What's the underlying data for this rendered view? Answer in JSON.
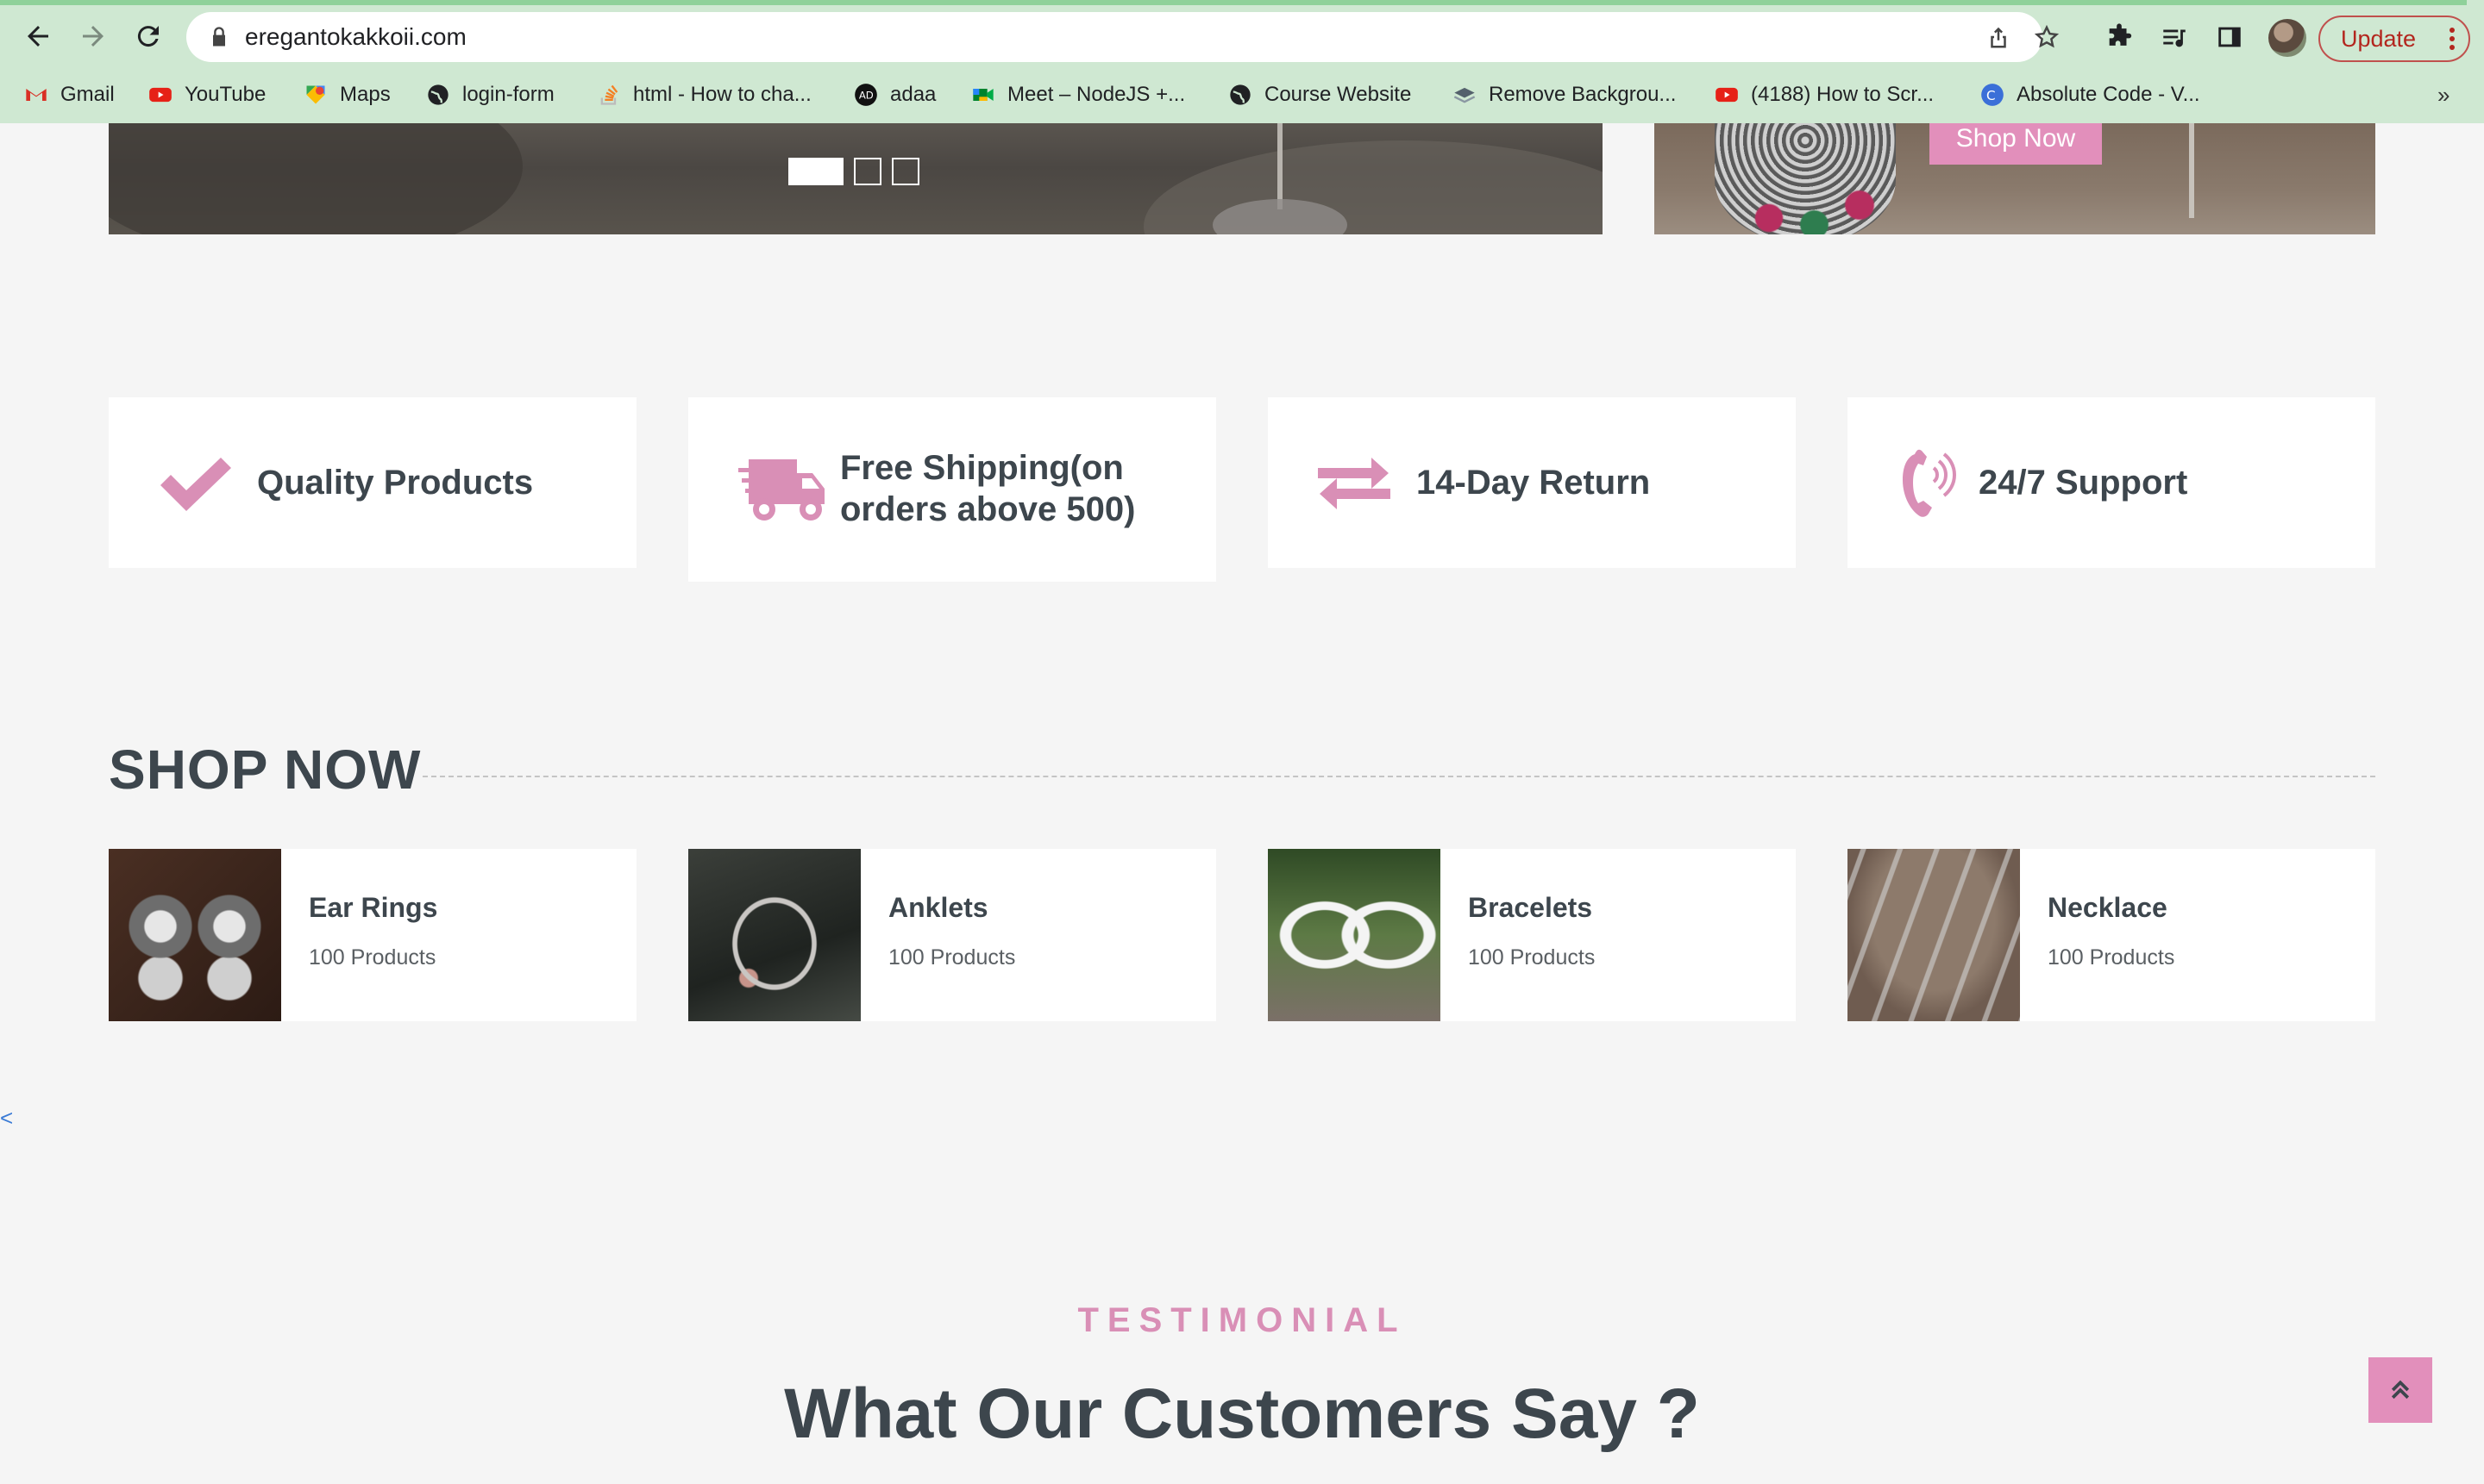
{
  "browser": {
    "url": "eregantokakkoii.com",
    "update_label": "Update",
    "bookmarks": [
      {
        "label": "Gmail",
        "icon": "gmail-icon"
      },
      {
        "label": "YouTube",
        "icon": "youtube-icon"
      },
      {
        "label": "Maps",
        "icon": "maps-icon"
      },
      {
        "label": "login-form",
        "icon": "globe-icon"
      },
      {
        "label": "html - How to cha...",
        "icon": "stackoverflow-icon"
      },
      {
        "label": "adaa",
        "icon": "adaa-icon"
      },
      {
        "label": "Meet – NodeJS +...",
        "icon": "meet-icon"
      },
      {
        "label": "Course Website",
        "icon": "globe-icon"
      },
      {
        "label": "Remove Backgrou...",
        "icon": "removebg-icon"
      },
      {
        "label": "(4188) How to Scr...",
        "icon": "youtube-icon"
      },
      {
        "label": "Absolute Code - V...",
        "icon": "absolute-code-icon"
      }
    ],
    "more_label": "»"
  },
  "hero": {
    "shop_now_label": "Shop Now"
  },
  "features": [
    {
      "label": "Quality Products",
      "icon": "check-icon"
    },
    {
      "label": "Free Shipping(on orders above 500)",
      "icon": "truck-icon"
    },
    {
      "label": "14-Day Return",
      "icon": "exchange-icon"
    },
    {
      "label": "24/7 Support",
      "icon": "phone-volume-icon"
    }
  ],
  "shop": {
    "title": "SHOP NOW",
    "categories": [
      {
        "name": "Ear Rings",
        "count": "100 Products"
      },
      {
        "name": "Anklets",
        "count": "100 Products"
      },
      {
        "name": "Bracelets",
        "count": "100 Products"
      },
      {
        "name": "Necklace",
        "count": "100 Products"
      }
    ]
  },
  "side_arrow": "<",
  "testimonial": {
    "kicker": "TESTIMONIAL",
    "title": "What Our Customers Say ?"
  },
  "colors": {
    "accent": "#e28fbb",
    "text": "#3d464d",
    "background": "#f5f5f5",
    "chrome": "#cfe8d2"
  }
}
